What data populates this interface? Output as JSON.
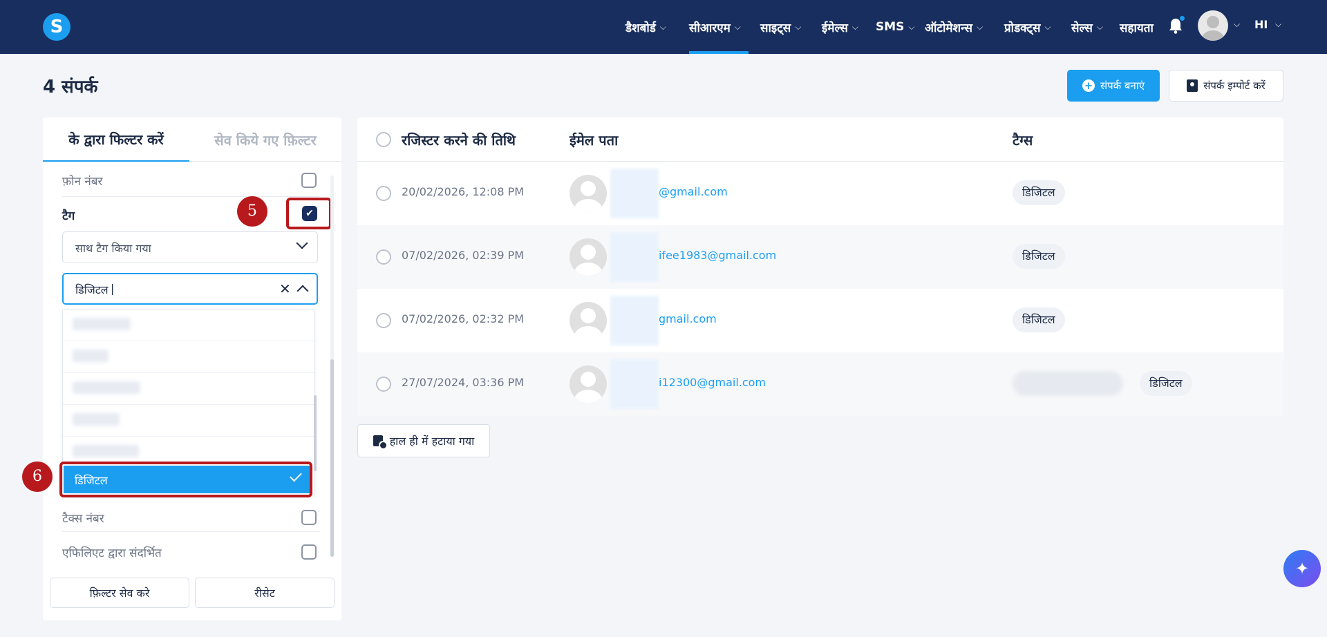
{
  "nav": {
    "items": [
      {
        "label": "डैशबोर्ड",
        "active": false
      },
      {
        "label": "सीआरएम",
        "active": true
      },
      {
        "label": "साइट्स",
        "active": false
      },
      {
        "label": "ईमेल्स",
        "active": false
      },
      {
        "label": "SMS",
        "active": false
      },
      {
        "label": "ऑटोमेशन्स",
        "active": false
      },
      {
        "label": "प्रोडक्ट्स",
        "active": false
      },
      {
        "label": "सेल्स",
        "active": false
      }
    ],
    "help_label": "सहायता",
    "language": "HI"
  },
  "page": {
    "title": "4 संपर्क",
    "create_button": "संपर्क बनाएं",
    "import_button": "संपर्क इम्पोर्ट करें"
  },
  "filter": {
    "tab_active": "के द्वारा फिल्टर करें",
    "tab_saved": "सेव किये गए फ़िल्टर",
    "phone_label": "फ़ोन नंबर",
    "tag_label": "टैग",
    "tag_mode": "साथ टैग किया गया",
    "tag_search_value": "डिजिटल",
    "selected_option": "डिजिटल",
    "tax_label": "टैक्स नंबर",
    "affiliate_label": "एफिलिएट द्वारा संदर्भित",
    "save_button": "फ़िल्टर सेव करे",
    "reset_button": "रीसेट"
  },
  "annotations": {
    "step5": "5",
    "step6": "6"
  },
  "table": {
    "headers": {
      "date": "रजिस्टर करने की तिथि",
      "email": "ईमेल पता",
      "tags": "टैग्स"
    },
    "rows": [
      {
        "date": "20/02/2026, 12:08 PM",
        "email": "@gmail.com",
        "tag": "डिजिटल"
      },
      {
        "date": "07/02/2026, 02:39 PM",
        "email": "ifee1983@gmail.com",
        "tag": "डिजिटल"
      },
      {
        "date": "07/02/2026, 02:32 PM",
        "email": "gmail.com",
        "tag": "डिजिटल"
      },
      {
        "date": "27/07/2024, 03:36 PM",
        "email": "i12300@gmail.com",
        "tag": "डिजिटल"
      }
    ]
  },
  "recently_deleted": "हाल ही में हटाया गया",
  "colors": {
    "navbar": "#182e5e",
    "accent": "#1b9ef0",
    "highlight": "#b8191c"
  }
}
